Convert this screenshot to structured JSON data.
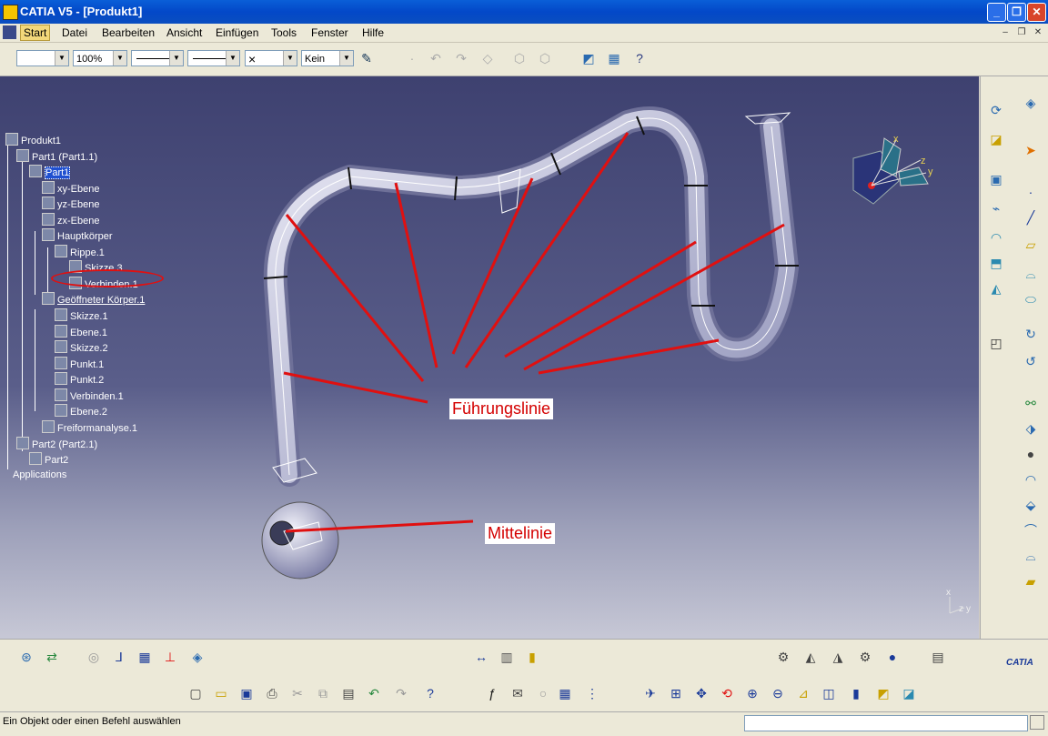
{
  "window": {
    "title": "CATIA V5 - [Produkt1]",
    "min": "_",
    "max": "❐",
    "close": "✕"
  },
  "menu": [
    "Start",
    "Datei",
    "Bearbeiten",
    "Ansicht",
    "Einfügen",
    "Tools",
    "Fenster",
    "Hilfe"
  ],
  "toolbar": {
    "zoom": "100%",
    "layer": "Kein",
    "cross": "×"
  },
  "tree": [
    {
      "label": "Produkt1"
    },
    {
      "label": "Part1 (Part1.1)"
    },
    {
      "label": "Part1"
    },
    {
      "label": "xy-Ebene"
    },
    {
      "label": "yz-Ebene"
    },
    {
      "label": "zx-Ebene"
    },
    {
      "label": "Hauptkörper"
    },
    {
      "label": "Rippe.1"
    },
    {
      "label": "Skizze.3"
    },
    {
      "label": "Verbinden.1"
    },
    {
      "label": "Geöffneter Körper.1"
    },
    {
      "label": "Skizze.1"
    },
    {
      "label": "Ebene.1"
    },
    {
      "label": "Skizze.2"
    },
    {
      "label": "Punkt.1"
    },
    {
      "label": "Punkt.2"
    },
    {
      "label": "Verbinden.1"
    },
    {
      "label": "Ebene.2"
    },
    {
      "label": "Freiformanalyse.1"
    },
    {
      "label": "Part2 (Part2.1)"
    },
    {
      "label": "Part2"
    },
    {
      "label": "Applications"
    }
  ],
  "callouts": {
    "guide": "Führungslinie",
    "center": "Mittelinie"
  },
  "axes": {
    "x": "x",
    "y": "y",
    "z": "z"
  },
  "status": {
    "prompt": "Ein Objekt oder einen Befehl auswählen"
  },
  "logo": "CATIA",
  "colors": {
    "annotation": "#d40000",
    "selection": "#2050d0"
  }
}
